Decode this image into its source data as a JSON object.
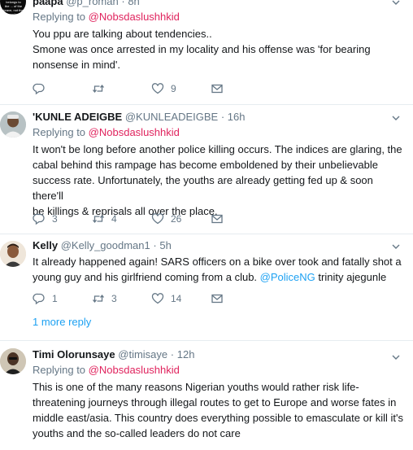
{
  "colors": {
    "accent": "#1da1f2",
    "mention": "#e0245e",
    "muted": "#657786",
    "text": "#14171a",
    "divider": "#e6ecf0"
  },
  "tweets": [
    {
      "name": "paapa",
      "handle": "@p_roman",
      "time": "8h",
      "reply_prefix": "Replying to",
      "reply_to": "@Nobsdaslushhkid",
      "lines": [
        "You ppu are talking about tendencies..",
        "Smone was once arrested in my locality and his offense was 'for bearing",
        "nonsense in mind'."
      ],
      "replies": "",
      "retweets": "",
      "likes": "9",
      "avatar_text": "The future belongs to the ... of the brave, not the comfort seekers"
    },
    {
      "name": "'KUNLE ADEIGBE",
      "handle": "@KUNLEADEIGBE",
      "time": "16h",
      "reply_prefix": "Replying to",
      "reply_to": "@Nobsdaslushhkid",
      "lines": [
        "It won't be long before another police killing occurs. The indices are glaring, the",
        "cabal behind this rampage has become emboldened by their unbelievable",
        "success rate. Unfortunately, the youths are already getting fed up & soon there'll",
        "be killings & reprisals all over the place."
      ],
      "replies": "3",
      "retweets": "4",
      "likes": "26"
    },
    {
      "name": "Kelly",
      "handle": "@Kelly_goodman1",
      "time": "5h",
      "lines": [
        "It already happened again! SARS officers on a bike over took and fatally shot a",
        "young guy and his girlfriend  coming from a club."
      ],
      "line2_link": "@PoliceNG",
      "line2_tail": " trinity ajegunle",
      "replies": "1",
      "retweets": "3",
      "likes": "14",
      "more_replies": "1 more reply"
    },
    {
      "name": "Timi Olorunsaye",
      "handle": "@timisaye",
      "time": "12h",
      "reply_prefix": "Replying to",
      "reply_to": "@Nobsdaslushhkid",
      "lines": [
        "This is one of the many reasons Nigerian youths would rather risk life-",
        "threatening journeys through illegal routes to get to Europe and worse fates in",
        "middle east/asia. This country does everything possible to emasculate or kill it's",
        "youths and the so-called leaders do not care"
      ]
    }
  ],
  "separator": "·"
}
